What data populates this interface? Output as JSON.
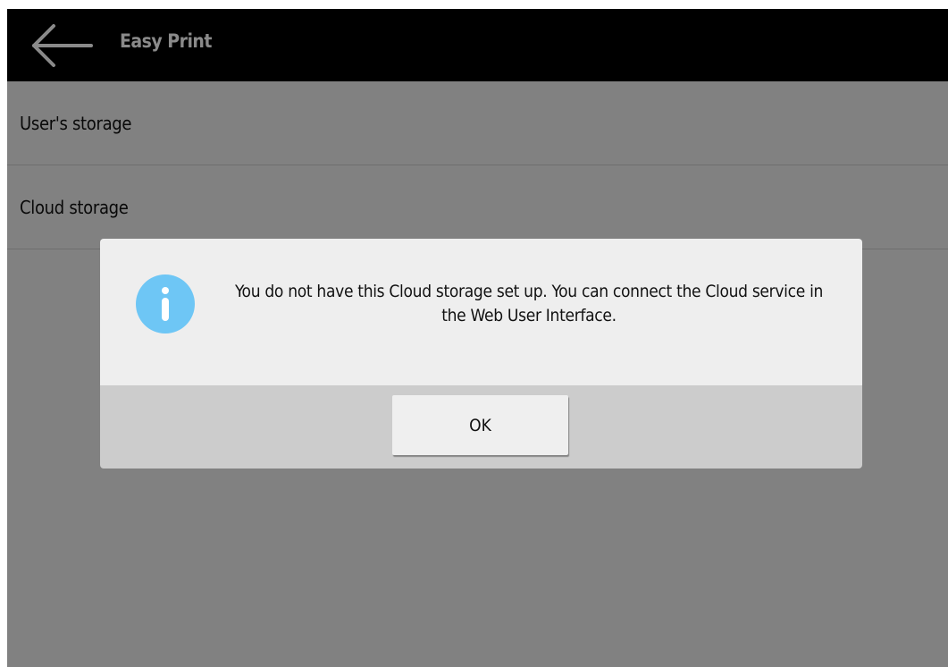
{
  "header": {
    "title": "Easy Print",
    "back_icon": "arrow-left-icon"
  },
  "list": {
    "items": [
      {
        "label": "User's storage"
      },
      {
        "label": "Cloud storage"
      }
    ]
  },
  "dialog": {
    "icon": "info-icon",
    "message": "You do not have this Cloud storage set up. You can connect the Cloud service in the Web User Interface.",
    "ok_label": "OK"
  },
  "colors": {
    "header_bg": "#000000",
    "info_icon": "#6ec6f5",
    "dialog_footer": "#cccccc"
  }
}
